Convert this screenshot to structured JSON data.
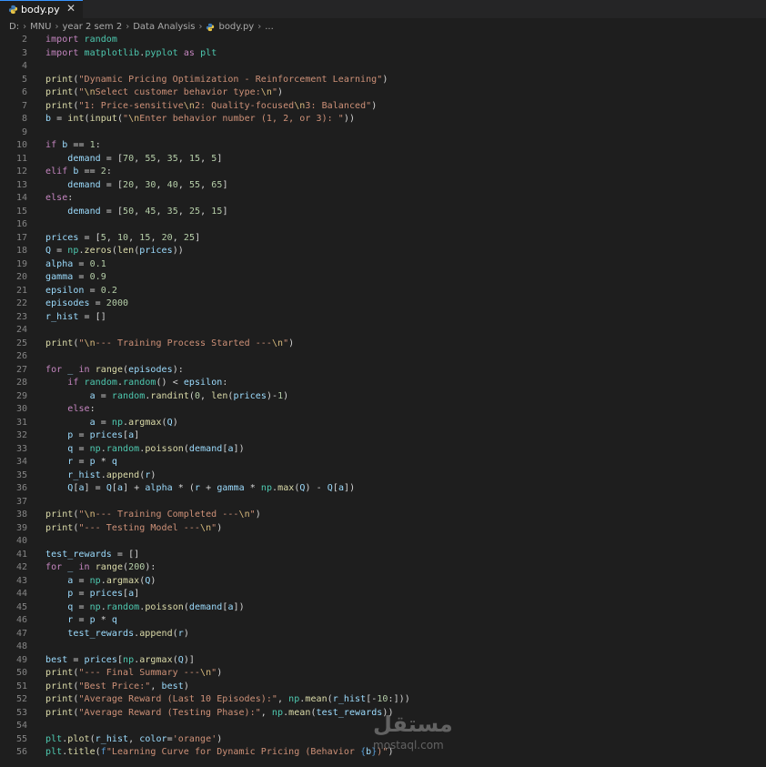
{
  "tab": {
    "title": "body.py",
    "close": "✕"
  },
  "breadcrumbs": [
    "D:",
    "MNU",
    "year 2 sem 2",
    "Data Analysis",
    "body.py",
    "..."
  ],
  "watermark": {
    "arabic": "مستقل",
    "latin": "mostaql.com"
  },
  "code_lines": [
    {
      "n": "2",
      "text": "import random"
    },
    {
      "n": "3",
      "text": "import matplotlib.pyplot as plt"
    },
    {
      "n": "4",
      "text": ""
    },
    {
      "n": "5",
      "text": "print(\"Dynamic Pricing Optimization - Reinforcement Learning\")"
    },
    {
      "n": "6",
      "text": "print(\"\\nSelect customer behavior type:\\n\")"
    },
    {
      "n": "7",
      "text": "print(\"1: Price-sensitive\\n2: Quality-focused\\n3: Balanced\")"
    },
    {
      "n": "8",
      "text": "b = int(input(\"\\nEnter behavior number (1, 2, or 3): \"))"
    },
    {
      "n": "9",
      "text": ""
    },
    {
      "n": "10",
      "text": "if b == 1:"
    },
    {
      "n": "11",
      "text": "    demand = [70, 55, 35, 15, 5]"
    },
    {
      "n": "12",
      "text": "elif b == 2:"
    },
    {
      "n": "13",
      "text": "    demand = [20, 30, 40, 55, 65]"
    },
    {
      "n": "14",
      "text": "else:"
    },
    {
      "n": "15",
      "text": "    demand = [50, 45, 35, 25, 15]"
    },
    {
      "n": "16",
      "text": ""
    },
    {
      "n": "17",
      "text": "prices = [5, 10, 15, 20, 25]"
    },
    {
      "n": "18",
      "text": "Q = np.zeros(len(prices))"
    },
    {
      "n": "19",
      "text": "alpha = 0.1"
    },
    {
      "n": "20",
      "text": "gamma = 0.9"
    },
    {
      "n": "21",
      "text": "epsilon = 0.2"
    },
    {
      "n": "22",
      "text": "episodes = 2000"
    },
    {
      "n": "23",
      "text": "r_hist = []"
    },
    {
      "n": "24",
      "text": ""
    },
    {
      "n": "25",
      "text": "print(\"\\n--- Training Process Started ---\\n\")"
    },
    {
      "n": "26",
      "text": ""
    },
    {
      "n": "27",
      "text": "for _ in range(episodes):"
    },
    {
      "n": "28",
      "text": "    if random.random() < epsilon:"
    },
    {
      "n": "29",
      "text": "        a = random.randint(0, len(prices)-1)"
    },
    {
      "n": "30",
      "text": "    else:"
    },
    {
      "n": "31",
      "text": "        a = np.argmax(Q)"
    },
    {
      "n": "32",
      "text": "    p = prices[a]"
    },
    {
      "n": "33",
      "text": "    q = np.random.poisson(demand[a])"
    },
    {
      "n": "34",
      "text": "    r = p * q"
    },
    {
      "n": "35",
      "text": "    r_hist.append(r)"
    },
    {
      "n": "36",
      "text": "    Q[a] = Q[a] + alpha * (r + gamma * np.max(Q) - Q[a])"
    },
    {
      "n": "37",
      "text": ""
    },
    {
      "n": "38",
      "text": "print(\"\\n--- Training Completed ---\\n\")"
    },
    {
      "n": "39",
      "text": "print(\"--- Testing Model ---\\n\")"
    },
    {
      "n": "40",
      "text": ""
    },
    {
      "n": "41",
      "text": "test_rewards = []"
    },
    {
      "n": "42",
      "text": "for _ in range(200):"
    },
    {
      "n": "43",
      "text": "    a = np.argmax(Q)"
    },
    {
      "n": "44",
      "text": "    p = prices[a]"
    },
    {
      "n": "45",
      "text": "    q = np.random.poisson(demand[a])"
    },
    {
      "n": "46",
      "text": "    r = p * q"
    },
    {
      "n": "47",
      "text": "    test_rewards.append(r)"
    },
    {
      "n": "48",
      "text": ""
    },
    {
      "n": "49",
      "text": "best = prices[np.argmax(Q)]"
    },
    {
      "n": "50",
      "text": "print(\"--- Final Summary ---\\n\")"
    },
    {
      "n": "51",
      "text": "print(\"Best Price:\", best)"
    },
    {
      "n": "52",
      "text": "print(\"Average Reward (Last 10 Episodes):\", np.mean(r_hist[-10:]))"
    },
    {
      "n": "53",
      "text": "print(\"Average Reward (Testing Phase):\", np.mean(test_rewards))"
    },
    {
      "n": "54",
      "text": ""
    },
    {
      "n": "55",
      "text": "plt.plot(r_hist, color='orange')"
    },
    {
      "n": "56",
      "text": "plt.title(f\"Learning Curve for Dynamic Pricing (Behavior {b})\")"
    }
  ]
}
